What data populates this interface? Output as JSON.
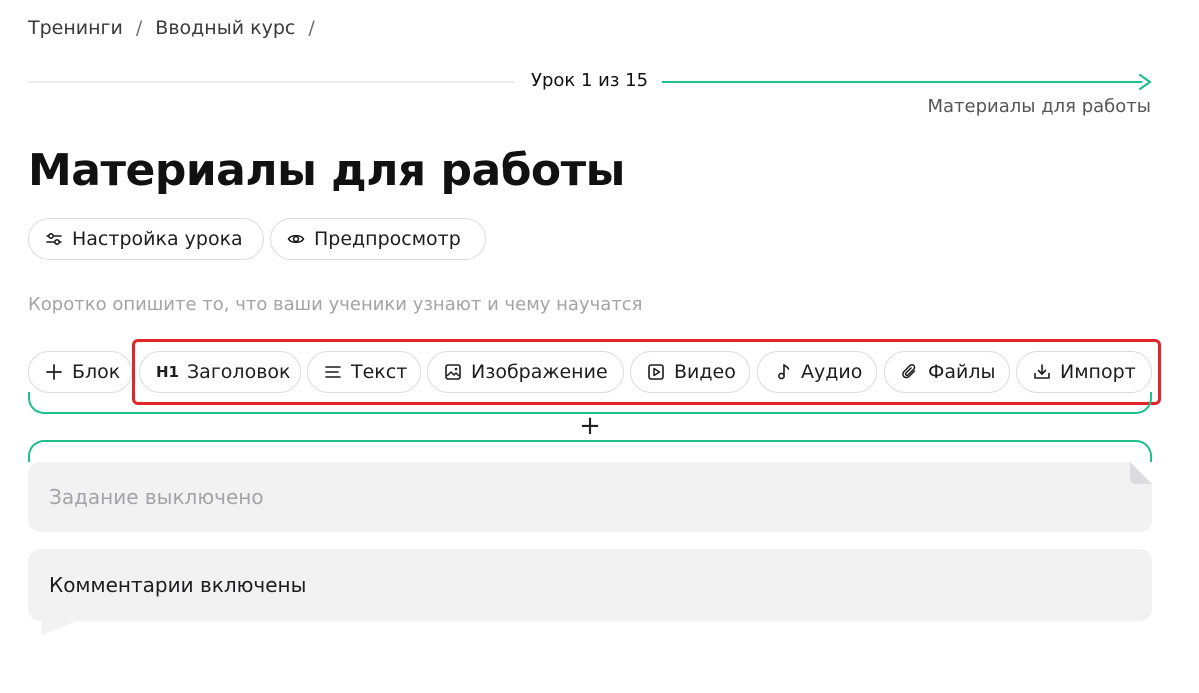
{
  "breadcrumb": {
    "items": [
      "Тренинги",
      "Вводный курс"
    ],
    "separator": "/"
  },
  "progress": {
    "label": "Урок 1 из 15",
    "next_lesson": "Материалы для работы",
    "accent_color": "#20c08b"
  },
  "page": {
    "title": "Материалы для работы",
    "description_placeholder": "Коротко опишите то, что ваши ученики узнают и чему научатся"
  },
  "actions": {
    "settings_label": "Настройка урока",
    "preview_label": "Предпросмотр"
  },
  "toolbar": {
    "add_block_label": "Блок",
    "heading_prefix": "H1",
    "items": [
      {
        "icon": "heading-icon",
        "label": "Заголовок"
      },
      {
        "icon": "text-lines-icon",
        "label": "Текст"
      },
      {
        "icon": "image-icon",
        "label": "Изображение"
      },
      {
        "icon": "video-icon",
        "label": "Видео"
      },
      {
        "icon": "music-note-icon",
        "label": "Аудио"
      },
      {
        "icon": "paperclip-icon",
        "label": "Файлы"
      },
      {
        "icon": "import-icon",
        "label": "Импорт"
      }
    ],
    "highlight_color": "#e0262b"
  },
  "insert": {
    "symbol": "+"
  },
  "cards": {
    "task_label": "Задание выключено",
    "comments_label": "Комментарии включены"
  }
}
